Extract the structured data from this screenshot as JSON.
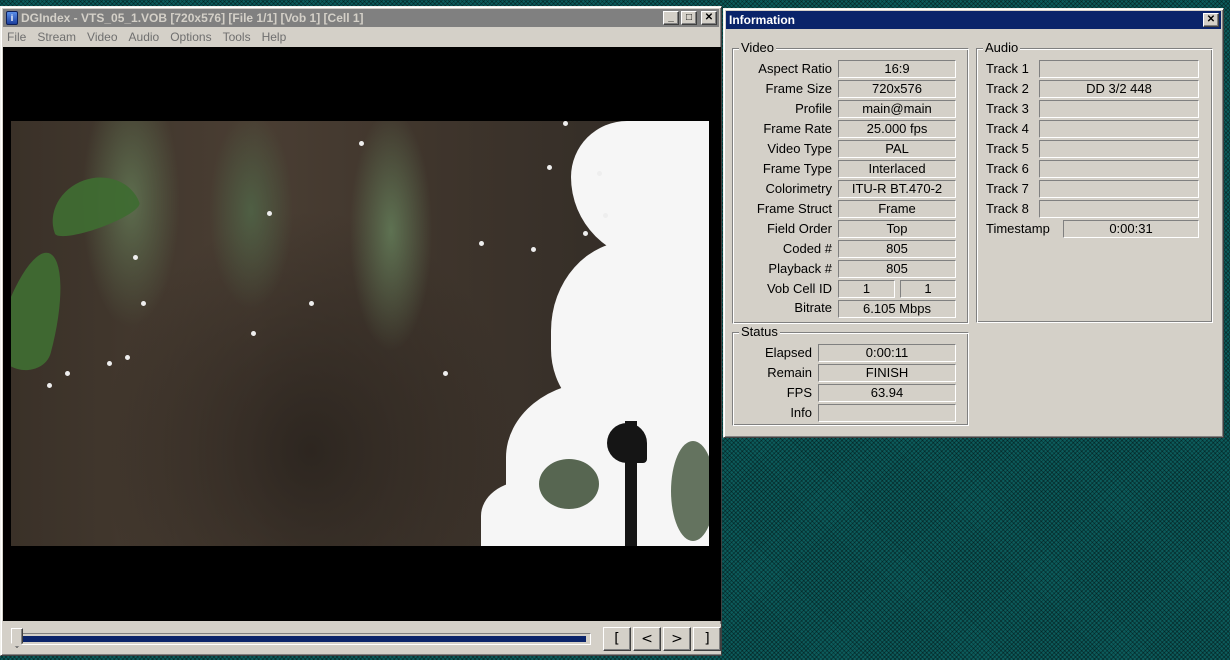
{
  "dgindex": {
    "title": "DGIndex - VTS_05_1.VOB [720x576] [File 1/1] [Vob 1] [Cell 1]",
    "menu": [
      "File",
      "Stream",
      "Video",
      "Audio",
      "Options",
      "Tools",
      "Help"
    ],
    "seek_progress": 0.995,
    "nav": {
      "mark_in": "[",
      "prev": "<",
      "next": ">",
      "mark_out": "]"
    }
  },
  "info": {
    "title": "Information",
    "video": {
      "label": "Video",
      "rows": [
        {
          "label": "Aspect Ratio",
          "value": "16:9"
        },
        {
          "label": "Frame Size",
          "value": "720x576"
        },
        {
          "label": "Profile",
          "value": "main@main"
        },
        {
          "label": "Frame Rate",
          "value": "25.000 fps"
        },
        {
          "label": "Video Type",
          "value": "PAL"
        },
        {
          "label": "Frame Type",
          "value": "Interlaced"
        },
        {
          "label": "Colorimetry",
          "value": "ITU-R BT.470-2"
        },
        {
          "label": "Frame Struct",
          "value": "Frame"
        },
        {
          "label": "Field Order",
          "value": "Top"
        },
        {
          "label": "Coded #",
          "value": "805"
        },
        {
          "label": "Playback #",
          "value": "805"
        }
      ],
      "vob_cell": {
        "label": "Vob Cell ID",
        "vob": "1",
        "cell": "1"
      },
      "bitrate": {
        "label": "Bitrate",
        "value": "6.105 Mbps"
      }
    },
    "audio": {
      "label": "Audio",
      "tracks": [
        {
          "label": "Track 1",
          "value": ""
        },
        {
          "label": "Track 2",
          "value": "DD 3/2 448"
        },
        {
          "label": "Track 3",
          "value": ""
        },
        {
          "label": "Track 4",
          "value": ""
        },
        {
          "label": "Track 5",
          "value": ""
        },
        {
          "label": "Track 6",
          "value": ""
        },
        {
          "label": "Track 7",
          "value": ""
        },
        {
          "label": "Track 8",
          "value": ""
        }
      ],
      "timestamp": {
        "label": "Timestamp",
        "value": "0:00:31"
      }
    },
    "status": {
      "label": "Status",
      "rows": [
        {
          "label": "Elapsed",
          "value": "0:00:11"
        },
        {
          "label": "Remain",
          "value": "FINISH"
        },
        {
          "label": "FPS",
          "value": "63.94"
        },
        {
          "label": "Info",
          "value": ""
        }
      ]
    }
  },
  "icons": {
    "minimize": "_",
    "maximize": "□",
    "close": "✕"
  }
}
